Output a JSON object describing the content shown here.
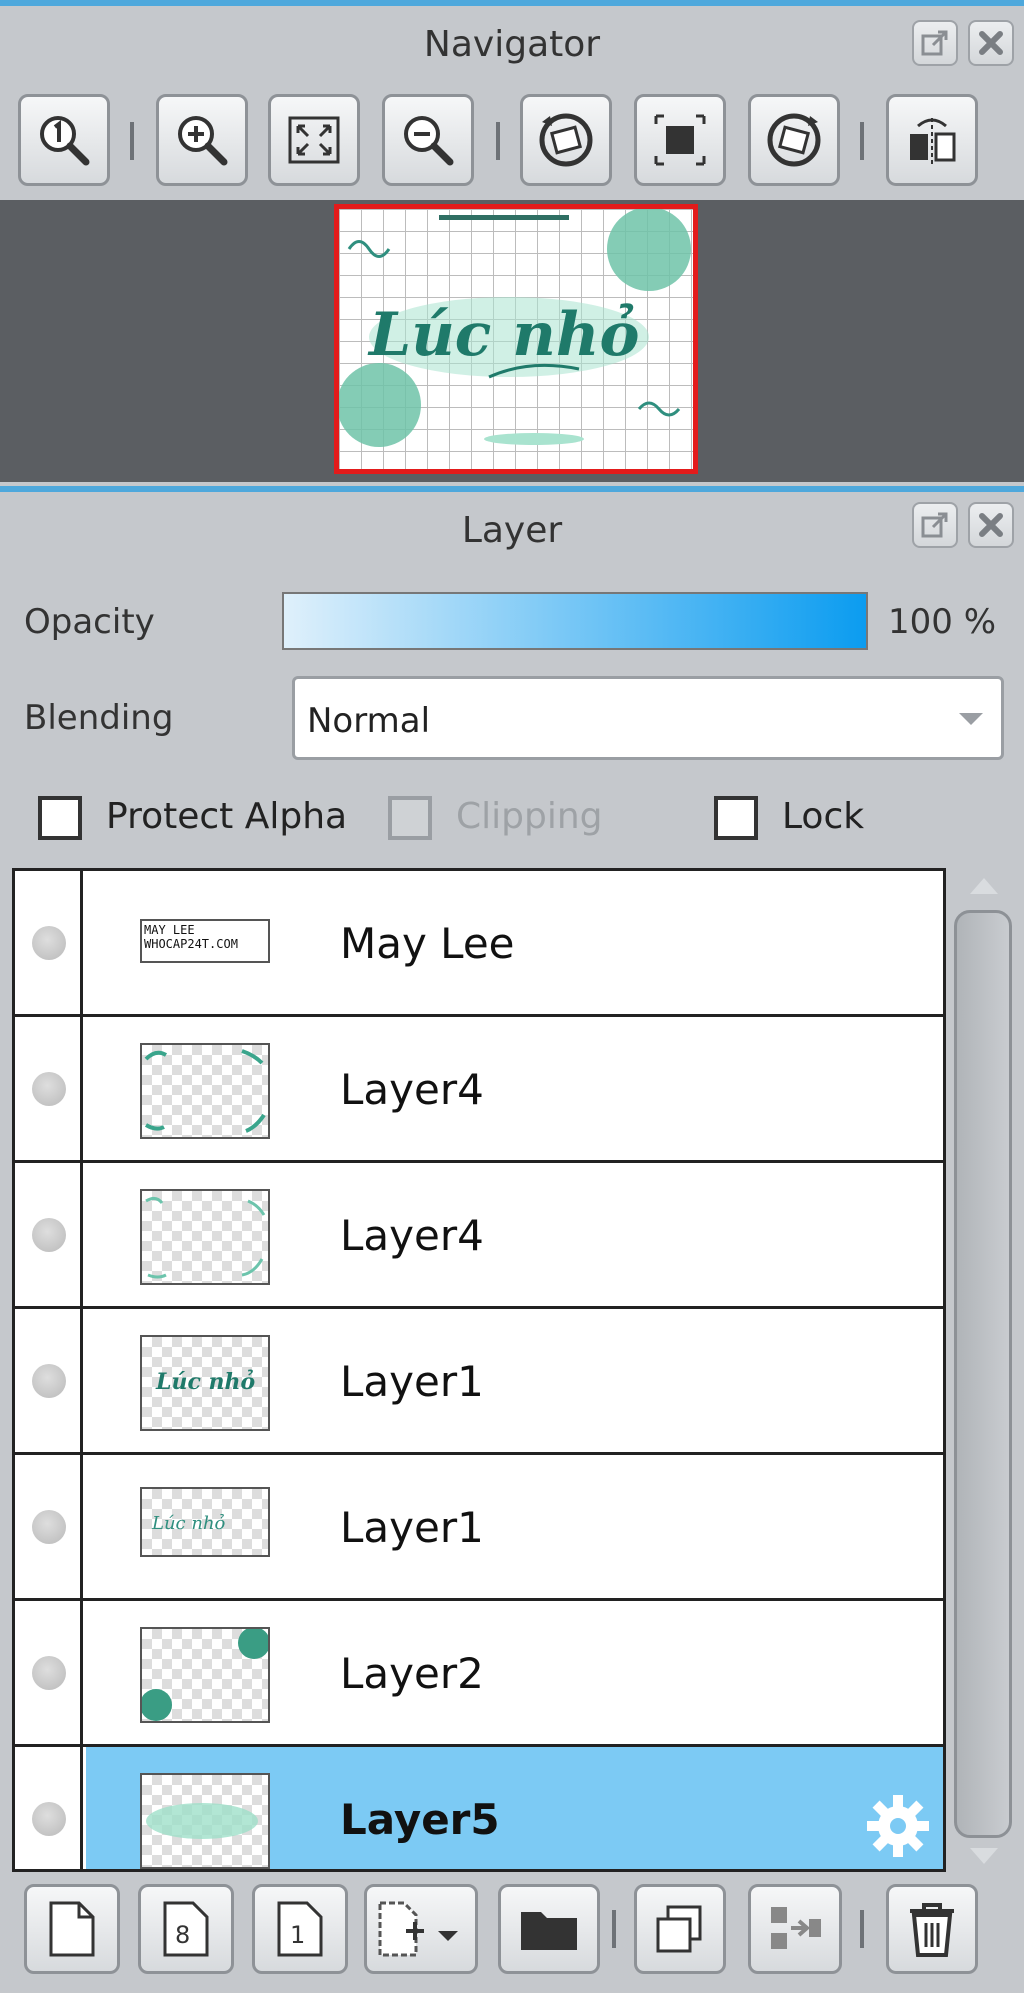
{
  "navigator": {
    "title": "Navigator",
    "toolbar": [
      "zoom-actual-size",
      "zoom-in",
      "fit-to-window",
      "zoom-out",
      "rotate-left",
      "reset-view",
      "rotate-right",
      "flip-horizontal"
    ],
    "thumb_text": "Lúc nhỏ"
  },
  "layer_panel": {
    "title": "Layer",
    "opacity_label": "Opacity",
    "opacity_value": "100 %",
    "opacity_fraction": 1.0,
    "blending_label": "Blending",
    "blending_value": "Normal",
    "protect_alpha_label": "Protect Alpha",
    "clipping_label": "Clipping",
    "lock_label": "Lock",
    "layers": [
      {
        "name": "May Lee",
        "thumb": "text",
        "thumb_text_1": "MAY LEE",
        "thumb_text_2": "WHOCAP24T.COM"
      },
      {
        "name": "Layer4",
        "thumb": "frame"
      },
      {
        "name": "Layer4",
        "thumb": "frame"
      },
      {
        "name": "Layer1",
        "thumb": "script",
        "thumb_text": "Lúc nhỏ"
      },
      {
        "name": "Layer1",
        "thumb": "script-small",
        "thumb_text": "Lúc nhỏ"
      },
      {
        "name": "Layer2",
        "thumb": "bubbles"
      },
      {
        "name": "Layer5",
        "thumb": "glow",
        "selected": true
      }
    ]
  },
  "colors": {
    "accent": "#4ea8dc",
    "selected_row": "#7ccaf4",
    "teal": "#2f8f7f",
    "thumb_border": "#e31b1b"
  }
}
